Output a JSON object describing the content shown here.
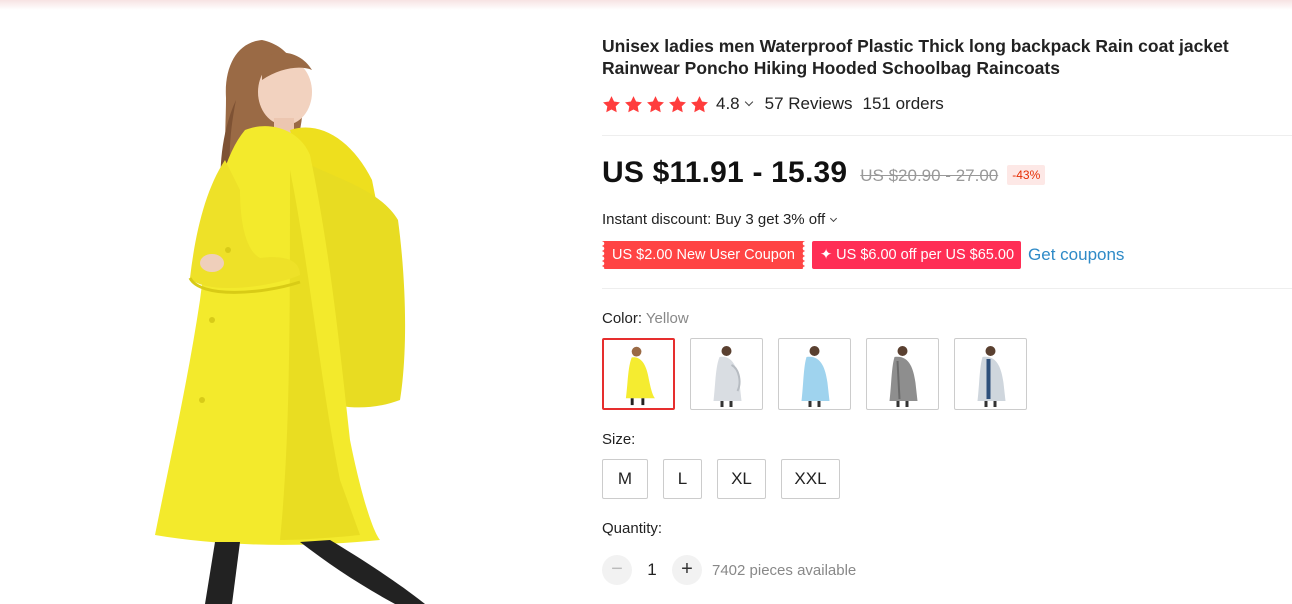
{
  "product": {
    "title": "Unisex ladies men Waterproof Plastic Thick long backpack Rain coat jacket Rainwear Poncho Hiking Hooded Schoolbag Raincoats",
    "image_alt": "Woman wearing yellow hooded raincoat over backpack"
  },
  "rating": {
    "stars": 5,
    "value": "4.8",
    "reviews": "57 Reviews",
    "orders": "151 orders",
    "star_color": "#ff3d3d"
  },
  "price": {
    "current": "US $11.91 - 15.39",
    "original": "US $20.90 - 27.00",
    "discount": "-43%"
  },
  "discount": {
    "instant": "Instant discount: Buy 3 get 3% off"
  },
  "coupons": {
    "new_user": "US $2.00 New User Coupon",
    "store": "✦ US $6.00 off per US $65.00",
    "get_label": "Get coupons"
  },
  "color": {
    "label": "Color: ",
    "selected": "Yellow",
    "options": [
      {
        "name": "Yellow",
        "coat": "#f5ec30"
      },
      {
        "name": "Clear",
        "coat": "#d9dde2"
      },
      {
        "name": "Blue",
        "coat": "#9fd3ee"
      },
      {
        "name": "Black",
        "coat": "#9a9a9a"
      },
      {
        "name": "White",
        "coat": "#cfd6dd"
      }
    ]
  },
  "size": {
    "label": "Size:",
    "options": [
      "M",
      "L",
      "XL",
      "XXL"
    ]
  },
  "quantity": {
    "label": "Quantity:",
    "minus": "−",
    "value": "1",
    "plus": "+",
    "available": "7402 pieces available"
  }
}
